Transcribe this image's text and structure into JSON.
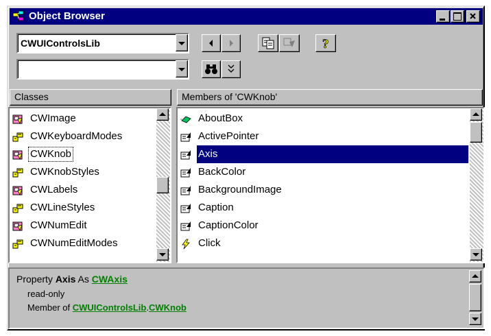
{
  "window": {
    "title": "Object Browser"
  },
  "toolbar": {
    "library_value": "CWUIControlsLib",
    "search_value": "",
    "help_label": "?"
  },
  "classes": {
    "header": "Classes",
    "items": [
      {
        "label": "CWImage",
        "icon": "class-icon"
      },
      {
        "label": "CWKeyboardModes",
        "icon": "enum-icon"
      },
      {
        "label": "CWKnob",
        "icon": "class-icon",
        "selected": true
      },
      {
        "label": "CWKnobStyles",
        "icon": "enum-icon"
      },
      {
        "label": "CWLabels",
        "icon": "class-icon"
      },
      {
        "label": "CWLineStyles",
        "icon": "enum-icon"
      },
      {
        "label": "CWNumEdit",
        "icon": "class-icon"
      },
      {
        "label": "CWNumEditModes",
        "icon": "enum-icon"
      }
    ]
  },
  "members": {
    "header": "Members of 'CWKnob'",
    "items": [
      {
        "label": "AboutBox",
        "icon": "method-icon"
      },
      {
        "label": "ActivePointer",
        "icon": "property-icon"
      },
      {
        "label": "Axis",
        "icon": "property-icon",
        "selected": true
      },
      {
        "label": "BackColor",
        "icon": "property-icon"
      },
      {
        "label": "BackgroundImage",
        "icon": "property-icon"
      },
      {
        "label": "Caption",
        "icon": "property-icon"
      },
      {
        "label": "CaptionColor",
        "icon": "property-icon"
      },
      {
        "label": "Click",
        "icon": "event-icon"
      }
    ]
  },
  "description": {
    "keyword": "Property",
    "member": "Axis",
    "as_word": "As",
    "type_link": "CWAxis",
    "line2": "read-only",
    "member_of": "Member of",
    "lib_link": "CWUIControlsLib",
    "dot": ".",
    "class_link": "CWKnob"
  },
  "colors": {
    "title_bar": "#000080",
    "selection": "#000080",
    "link": "#008000",
    "face": "#c0c0c0"
  }
}
